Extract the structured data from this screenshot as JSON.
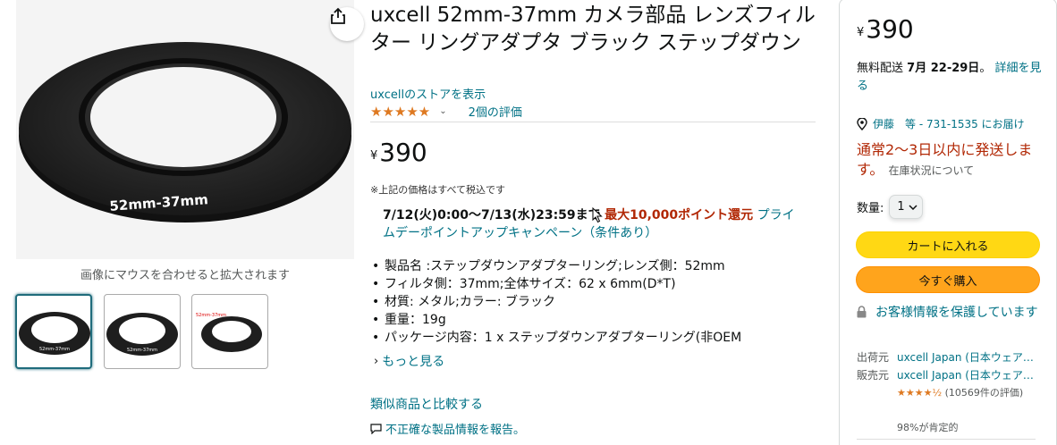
{
  "gallery": {
    "main_image_label": "52mm-37mm",
    "zoom_hint": "画像にマウスを合わせると拡大されます",
    "thumbnails": [
      {
        "label": "52mm-37mm",
        "selected": true
      },
      {
        "label": "52mm-37mm",
        "selected": false
      },
      {
        "label": "52mm-37mm",
        "selected": false
      }
    ]
  },
  "product": {
    "title": "uxcell 52mm-37mm カメラ部品 レンズフィルター リングアダプタ ブラック ステップダウン",
    "store_link": "uxcellのストアを表示",
    "rating_stars": "★★★★★",
    "rating_count": "2個の評価",
    "price_symbol": "¥",
    "price": "390",
    "tax_note": "※上記の価格はすべて税込です",
    "promo": {
      "period": "7/12(火)0:00〜7/13(水)23:59まで",
      "points": "最大10,000ポイント還元",
      "campaign": "プライムデーポイントアップキャンペーン（条件あり）"
    },
    "bullets": [
      "製品名 :ステップダウンアダプターリング;レンズ側：52mm",
      "フィルタ側：37mm;全体サイズ：62 x 6mm(D*T)",
      "材質: メタル;カラー: ブラック",
      "重量：19g",
      "パッケージ内容：1 x ステップダウンアダプターリング(非OEM"
    ],
    "more_link": "もっと見る",
    "compare_link": "類似商品と比較する",
    "report_link": "不正確な製品情報を報告。"
  },
  "buybox": {
    "price_symbol": "¥",
    "price": "390",
    "delivery_prefix": "無料配送",
    "delivery_date": "7月 22-29日",
    "delivery_suffix": "。",
    "delivery_link": "詳細を見る",
    "location": "伊藤　等 - 731-1535 にお届け",
    "stock_text": "通常2～3日以内に発送します。",
    "stock_link": "在庫状況について",
    "qty_label": "数量:",
    "qty_value": "1",
    "add_to_cart": "カートに入れる",
    "buy_now": "今すぐ購入",
    "secure_text": "お客様情報を保護しています",
    "shipper_label": "出荷元",
    "shipper_value": "uxcell Japan (日本ウェア…",
    "seller_label": "販売元",
    "seller_value": "uxcell Japan (日本ウェア…",
    "seller_stars": "★★★★½",
    "seller_rating_count": "(10569件の評価)",
    "seller_positive": "98%が肯定的"
  },
  "colors": {
    "link": "#007185",
    "star": "#de7921",
    "cart_button": "#ffd814",
    "buy_button": "#ffa41c",
    "stock_red": "#b12704"
  },
  "icons": [
    "share-icon",
    "chevron-down-icon",
    "chevron-right-icon",
    "report-icon",
    "location-pin-icon",
    "lock-icon",
    "mouse-cursor-icon"
  ]
}
